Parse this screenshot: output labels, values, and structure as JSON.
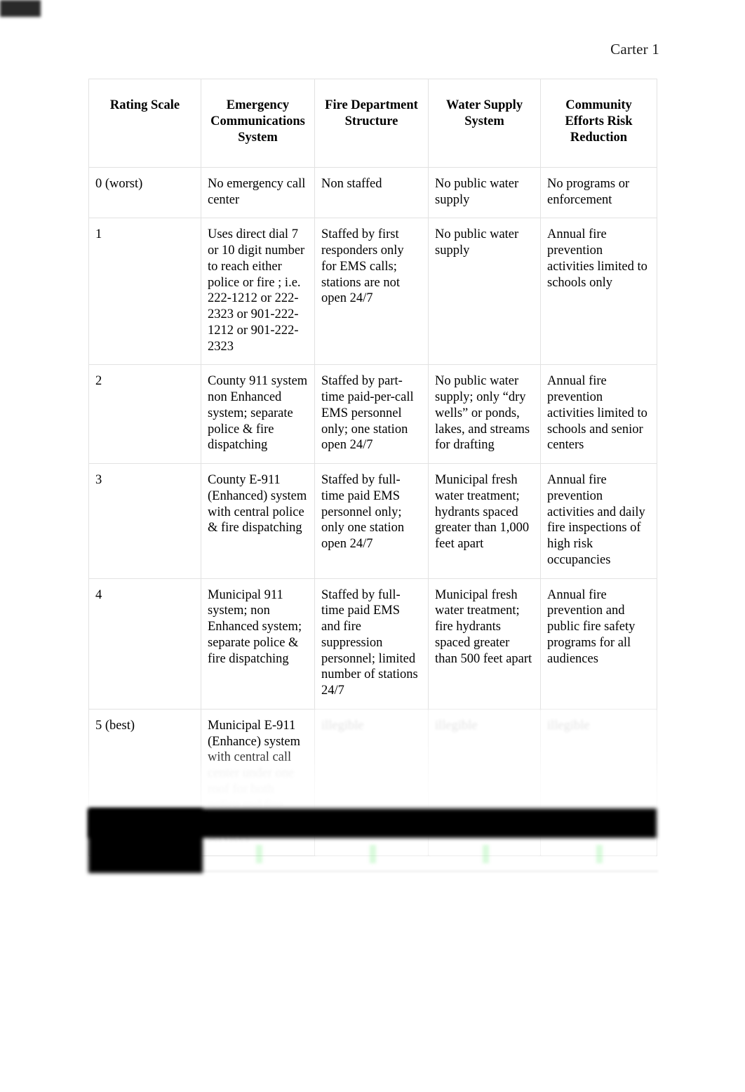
{
  "document": {
    "running_header": "Carter 1"
  },
  "table": {
    "name": "fire-protection-rating-scale-table",
    "columns": [
      "Rating Scale",
      "Emergency Communications System",
      "Fire Department Structure",
      "Water Supply System",
      "Community Efforts Risk Reduction"
    ],
    "rows": [
      {
        "scale": "0 (worst)",
        "emergency_communications": "No emergency call center",
        "fire_department_structure": "Non staffed",
        "water_supply": "No public water supply",
        "community_efforts": "No programs or enforcement",
        "legible": true
      },
      {
        "scale": "1",
        "emergency_communications": "Uses direct dial 7 or 10 digit number to reach either police or fire ; i.e. 222-1212 or 222-2323 or 901-222-1212 or 901-222-2323",
        "fire_department_structure": "Staffed by first responders only for EMS calls; stations are not open 24/7",
        "water_supply": "No public water supply",
        "community_efforts": "Annual fire prevention activities limited to schools only",
        "legible": true
      },
      {
        "scale": "2",
        "emergency_communications": "County 911 system non Enhanced system; separate police & fire dispatching",
        "fire_department_structure": "Staffed by part-time paid-per-call EMS personnel only; one station open 24/7",
        "water_supply": "No public water supply; only “dry wells” or ponds, lakes, and streams for drafting",
        "community_efforts": "Annual fire prevention activities limited to schools and senior centers",
        "legible": true
      },
      {
        "scale": "3",
        "emergency_communications": "County E-911 (Enhanced) system with central police & fire dispatching",
        "fire_department_structure": "Staffed by full-time paid EMS personnel only; only one station open 24/7",
        "water_supply": "Municipal fresh water treatment; hydrants spaced greater than 1,000 feet apart",
        "community_efforts": "Annual fire prevention activities and daily fire inspections of high risk occupancies",
        "legible": true
      },
      {
        "scale": "4",
        "emergency_communications": "Municipal 911 system; non Enhanced system; separate police & fire dispatching",
        "fire_department_structure": "Staffed by full-time paid EMS and fire suppression personnel; limited number of stations 24/7",
        "water_supply": "Municipal fresh water treatment; fire hydrants spaced greater than 500 feet apart",
        "community_efforts": "Annual fire prevention and public fire safety programs for all audiences",
        "legible": true
      },
      {
        "scale": "5 (best)",
        "emergency_communications_visible": "Municipal E-911 (Enhance) system with central call",
        "emergency_communications_illegible": "center under one roof for both police and fire dispatching services",
        "fire_department_structure": "illegible",
        "water_supply": "illegible",
        "community_efforts": "illegible",
        "legible": false
      }
    ]
  },
  "redactions": {
    "bar_label": "redaction-bar",
    "count": 2,
    "color": "#000000"
  }
}
